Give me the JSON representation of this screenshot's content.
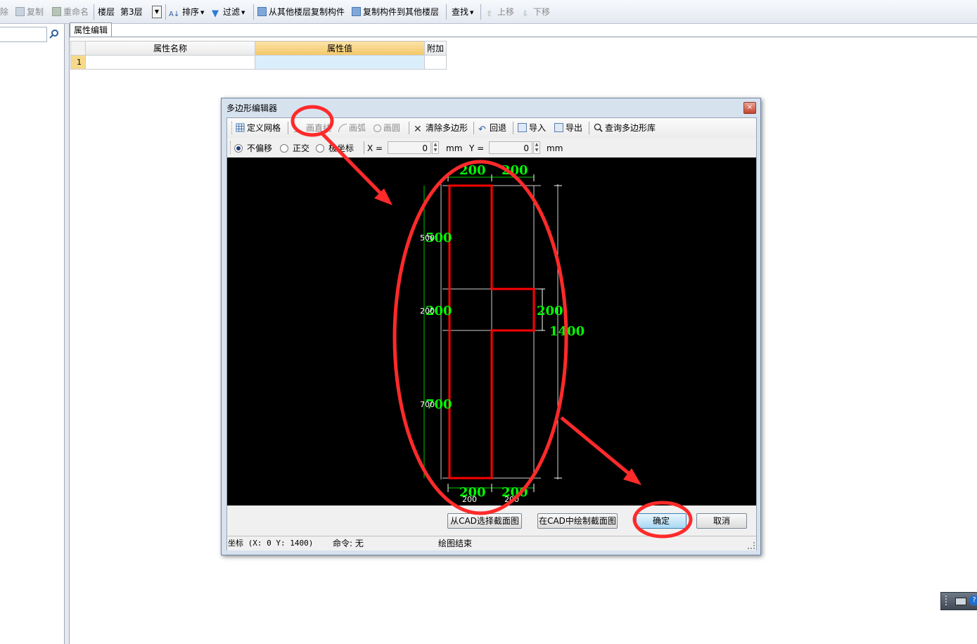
{
  "toolbar": {
    "delete_label": "除",
    "copy_label": "复制",
    "rename_label": "重命名",
    "floor_label": "楼层",
    "floor_value": "第3层",
    "sort_label": "排序",
    "filter_label": "过滤",
    "copy_from_label": "从其他楼层复制构件",
    "copy_to_label": "复制构件到其他楼层",
    "find_label": "查找",
    "up_label": "上移",
    "down_label": "下移"
  },
  "props": {
    "tab_label": "属性编辑",
    "headers": [
      "属性名称",
      "属性值",
      "附加"
    ],
    "rows": [
      {
        "num": "1",
        "name": "",
        "value": "",
        "extra": ""
      }
    ]
  },
  "dialog": {
    "title": "多边形编辑器",
    "close_glyph": "×",
    "toolbar": {
      "define_grid": "定义网格",
      "draw_line": "画直线",
      "draw_arc": "画弧",
      "draw_circle": "画圆",
      "clear": "清除多边形",
      "undo": "回退",
      "import": "导入",
      "export": "导出",
      "query": "查询多边形库"
    },
    "options": {
      "no_offset": "不偏移",
      "ortho": "正交",
      "polar": "极坐标",
      "x_label": "X =",
      "x_value": "0",
      "y_label": "Y =",
      "y_value": "0",
      "unit": "mm"
    },
    "canvas_labels": {
      "top_left": "200",
      "top_right": "200",
      "left_upper": "500",
      "left_upper_small": "500",
      "left_mid": "200",
      "left_mid_small": "200",
      "left_lower": "700",
      "left_lower_small": "700",
      "right_mid": "200",
      "right_total": "1400",
      "bottom_left": "200",
      "bottom_right": "200",
      "bottom_left_small": "200",
      "bottom_right_small": "200"
    },
    "buttons": {
      "pick_cad": "从CAD选择截面图",
      "draw_cad": "在CAD中绘制截面图",
      "ok": "确定",
      "cancel": "取消"
    },
    "status": {
      "coords": "坐标 (X: 0 Y: 1400)",
      "command": "命令: 无",
      "message": "绘图结束"
    }
  },
  "colors": {
    "shape": "#ff0000",
    "dimension": "#00ff00",
    "annotation": "#ff2020",
    "canvas_bg": "#000000"
  }
}
